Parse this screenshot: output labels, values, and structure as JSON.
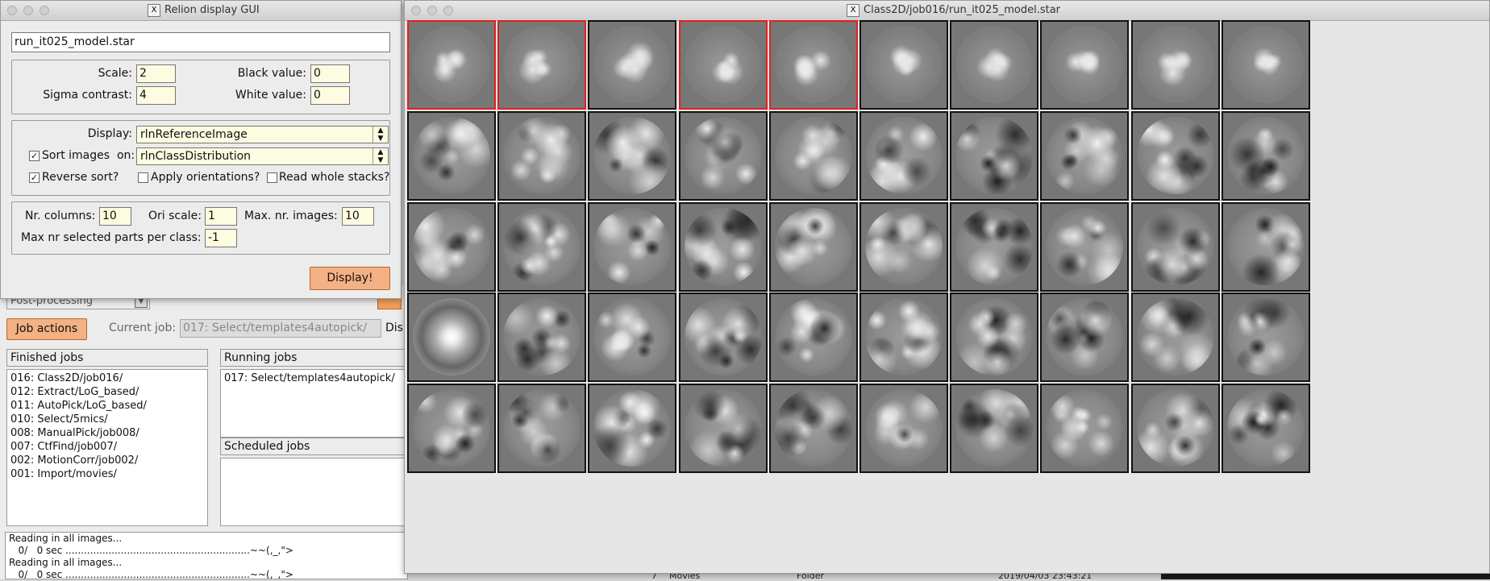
{
  "background_listing": {
    "num": "7",
    "name": "Movies",
    "kind": "Folder",
    "date": "2019/04/03 23:43:21"
  },
  "main_window": {
    "process_select": "Post-processing",
    "job_actions_label": "Job actions",
    "current_job_label": "Current job:",
    "current_job_value": "017: Select/templates4autopick/",
    "display_label_cut": "Disp",
    "finished_jobs_header": "Finished jobs",
    "finished_jobs": [
      "016: Class2D/job016/",
      "012: Extract/LoG_based/",
      "011: AutoPick/LoG_based/",
      "010: Select/5mics/",
      "008: ManualPick/job008/",
      "007: CtfFind/job007/",
      "002: MotionCorr/job002/",
      "001: Import/movies/"
    ],
    "running_jobs_header": "Running jobs",
    "running_jobs": [
      "017: Select/templates4autopick/"
    ],
    "scheduled_jobs_header": "Scheduled jobs",
    "scheduled_jobs": [],
    "log_lines": [
      "Reading in all images...",
      "   0/   0 sec ............................................................~~(,_,\">",
      "Reading in all images...",
      "   0/   0 sec ............................................................~~(,_,\">"
    ]
  },
  "display_dialog": {
    "title": "Relion display GUI",
    "filename": "run_it025_model.star",
    "scale_label": "Scale:",
    "scale_value": "2",
    "black_label": "Black value:",
    "black_value": "0",
    "sigma_label": "Sigma contrast:",
    "sigma_value": "4",
    "white_label": "White value:",
    "white_value": "0",
    "display_label": "Display:",
    "display_value": "rlnReferenceImage",
    "sort_label": "Sort images  on:",
    "sort_checked": true,
    "sort_value": "rlnClassDistribution",
    "reverse_label": "Reverse sort?",
    "reverse_checked": true,
    "apply_label": "Apply orientations?",
    "apply_checked": false,
    "read_label": "Read whole stacks?",
    "read_checked": false,
    "nrcols_label": "Nr. columns:",
    "nrcols_value": "10",
    "oriscale_label": "Ori scale:",
    "oriscale_value": "1",
    "maximg_label": "Max. nr. images:",
    "maximg_value": "10",
    "maxsel_label": "Max nr selected parts per class:",
    "maxsel_value": "-1",
    "display_button": "Display!"
  },
  "class_window": {
    "title": "Class2D/job016/run_it025_model.star",
    "rows": 5,
    "columns": 10,
    "selected_classes": [
      1,
      2,
      4,
      5
    ]
  },
  "colors": {
    "selection_border": "#e02020",
    "button_orange": "#f4b183",
    "field_yellow": "#fdfbe0"
  }
}
